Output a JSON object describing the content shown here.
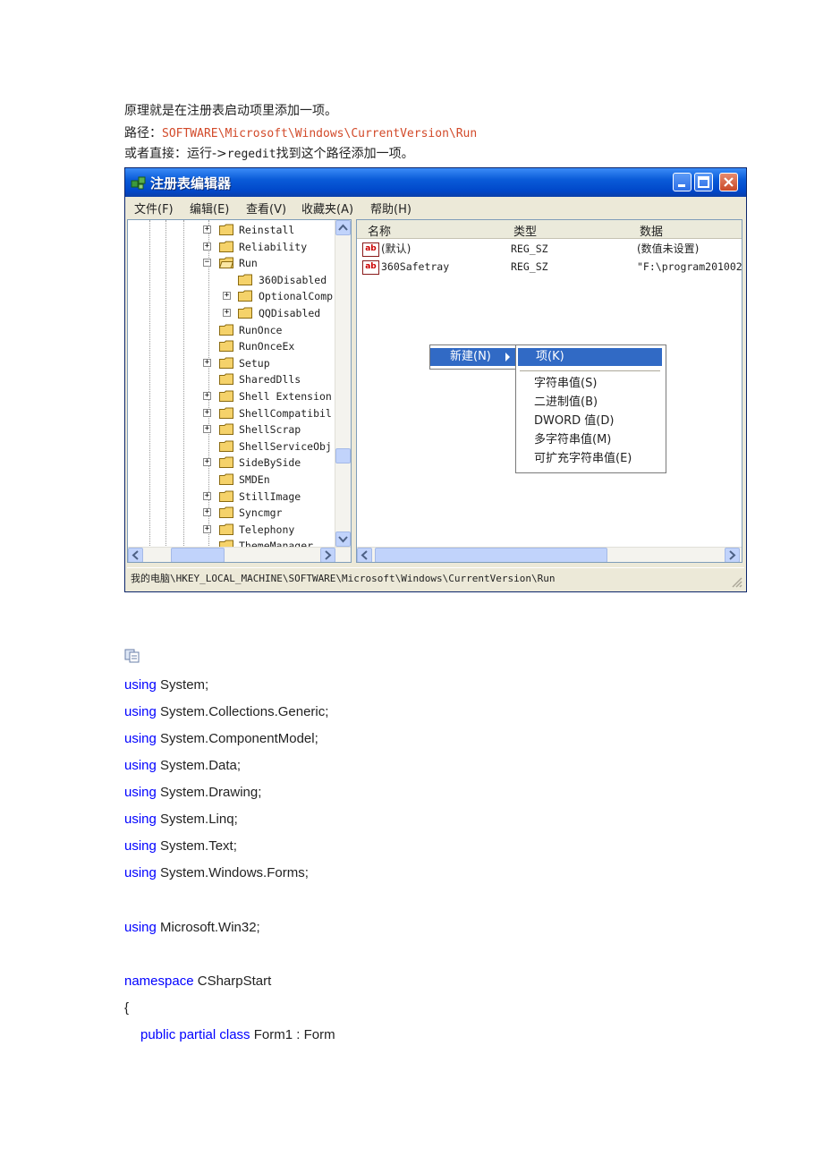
{
  "intro": {
    "line1": "原理就是在注册表启动项里添加一项。",
    "line2_label": "路径：",
    "line2_path": "SOFTWARE\\Microsoft\\Windows\\CurrentVersion\\Run",
    "line3_a": "或者直接：运行->",
    "line3_b": "regedit",
    "line3_c": "找到这个路径添加一项。"
  },
  "window": {
    "title": "注册表编辑器",
    "menu": [
      "文件(F)",
      "编辑(E)",
      "查看(V)",
      "收藏夹(A)",
      "帮助(H)"
    ],
    "tree": [
      {
        "label": "Reinstall",
        "expander": "+",
        "level": 1
      },
      {
        "label": "Reliability",
        "expander": "+",
        "level": 1
      },
      {
        "label": "Run",
        "expander": "-",
        "level": 1,
        "open": true
      },
      {
        "label": "360Disabled",
        "expander": "",
        "level": 2
      },
      {
        "label": "OptionalComp",
        "expander": "+",
        "level": 2
      },
      {
        "label": "QQDisabled",
        "expander": "+",
        "level": 2
      },
      {
        "label": "RunOnce",
        "expander": "",
        "level": 1
      },
      {
        "label": "RunOnceEx",
        "expander": "",
        "level": 1
      },
      {
        "label": "Setup",
        "expander": "+",
        "level": 1
      },
      {
        "label": "SharedDlls",
        "expander": "",
        "level": 1
      },
      {
        "label": "Shell Extension",
        "expander": "+",
        "level": 1
      },
      {
        "label": "ShellCompatibil",
        "expander": "+",
        "level": 1
      },
      {
        "label": "ShellScrap",
        "expander": "+",
        "level": 1
      },
      {
        "label": "ShellServiceObj",
        "expander": "",
        "level": 1
      },
      {
        "label": "SideBySide",
        "expander": "+",
        "level": 1
      },
      {
        "label": "SMDEn",
        "expander": "",
        "level": 1
      },
      {
        "label": "StillImage",
        "expander": "+",
        "level": 1
      },
      {
        "label": "Syncmgr",
        "expander": "+",
        "level": 1
      },
      {
        "label": "Telephony",
        "expander": "+",
        "level": 1
      },
      {
        "label": "ThemeManager",
        "expander": "",
        "level": 1
      }
    ],
    "columns": {
      "name": "名称",
      "type": "类型",
      "data": "数据"
    },
    "values": [
      {
        "name": "(默认)",
        "type": "REG_SZ",
        "data": "(数值未设置)",
        "icon": "ab"
      },
      {
        "name": "360Safetray",
        "type": "REG_SZ",
        "data": "\"F:\\program201002",
        "icon": "ab"
      }
    ],
    "context_menu": {
      "new_label": "新建(N)",
      "submenu": [
        "项(K)",
        "字符串值(S)",
        "二进制值(B)",
        "DWORD 值(D)",
        "多字符串值(M)",
        "可扩充字符串值(E)"
      ]
    },
    "status": "我的电脑\\HKEY_LOCAL_MACHINE\\SOFTWARE\\Microsoft\\Windows\\CurrentVersion\\Run"
  },
  "code": [
    {
      "kw": "using",
      "rest": " System;"
    },
    {
      "kw": "using",
      "rest": " System.Collections.Generic;"
    },
    {
      "kw": "using",
      "rest": " System.ComponentModel;"
    },
    {
      "kw": "using",
      "rest": " System.Data;"
    },
    {
      "kw": "using",
      "rest": " System.Drawing;"
    },
    {
      "kw": "using",
      "rest": " System.Linq;"
    },
    {
      "kw": "using",
      "rest": " System.Text;"
    },
    {
      "kw": "using",
      "rest": " System.Windows.Forms;"
    },
    {
      "kw": "using",
      "rest": " Microsoft.Win32;"
    },
    {
      "kw": "namespace",
      "rest": " CSharpStart"
    },
    {
      "kw": "",
      "rest": "{"
    },
    {
      "kw": "public partial class",
      "rest": " Form1 : Form"
    }
  ]
}
